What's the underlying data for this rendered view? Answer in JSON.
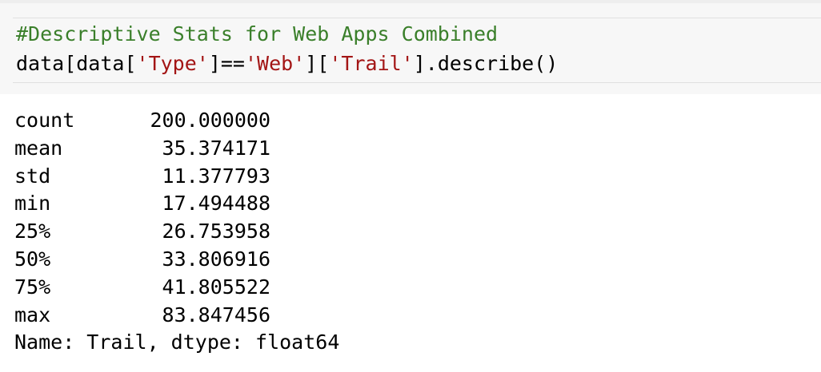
{
  "input_cell": {
    "comment": "#Descriptive Stats for Web Apps Combined",
    "code": {
      "part1": "data[data[",
      "str1": "'Type'",
      "part2": "]==",
      "str2": "'Web'",
      "part3": "][",
      "str3": "'Trail'",
      "part4": "].describe()"
    }
  },
  "output": {
    "rows": [
      {
        "label": "count",
        "value": "200.000000"
      },
      {
        "label": "mean",
        "value": "35.374171"
      },
      {
        "label": "std",
        "value": "11.377793"
      },
      {
        "label": "min",
        "value": "17.494488"
      },
      {
        "label": "25%",
        "value": "26.753958"
      },
      {
        "label": "50%",
        "value": "33.806916"
      },
      {
        "label": "75%",
        "value": "41.805522"
      },
      {
        "label": "max",
        "value": "83.847456"
      }
    ],
    "footer": "Name: Trail, dtype: float64"
  },
  "colors": {
    "comment": "#3a7f2a",
    "string": "#a31515",
    "cell_background": "#f7f7f7"
  }
}
